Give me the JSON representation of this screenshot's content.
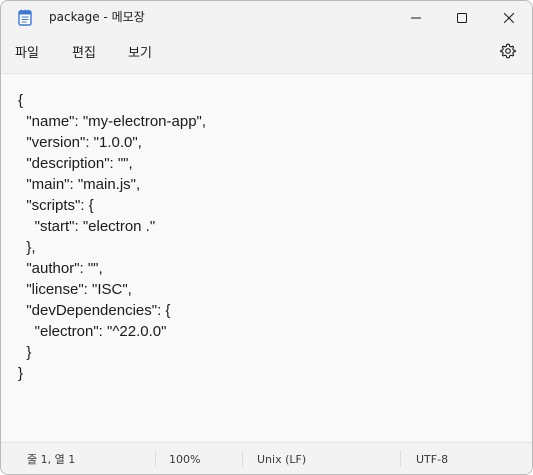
{
  "window": {
    "title": "package - 메모장",
    "icon": "notepad-icon",
    "controls": {
      "minimize": "minimize-icon",
      "maximize": "maximize-icon",
      "close": "close-icon"
    }
  },
  "menu": {
    "file": "파일",
    "edit": "편집",
    "view": "보기",
    "settings_icon": "gear-icon"
  },
  "editor": {
    "content": "{\n  \"name\": \"my-electron-app\",\n  \"version\": \"1.0.0\",\n  \"description\": \"\",\n  \"main\": \"main.js\",\n  \"scripts\": {\n    \"start\": \"electron .\"\n  },\n  \"author\": \"\",\n  \"license\": \"ISC\",\n  \"devDependencies\": {\n    \"electron\": \"^22.0.0\"\n  }\n}"
  },
  "status": {
    "position": "줄 1, 열 1",
    "zoom": "100%",
    "line_ending": "Unix (LF)",
    "encoding": "UTF-8"
  },
  "colors": {
    "chrome": "#f3f3f3",
    "editor_bg": "#f9f9f9",
    "text": "#1b1b1b",
    "icon_blue": "#3b78d8"
  }
}
